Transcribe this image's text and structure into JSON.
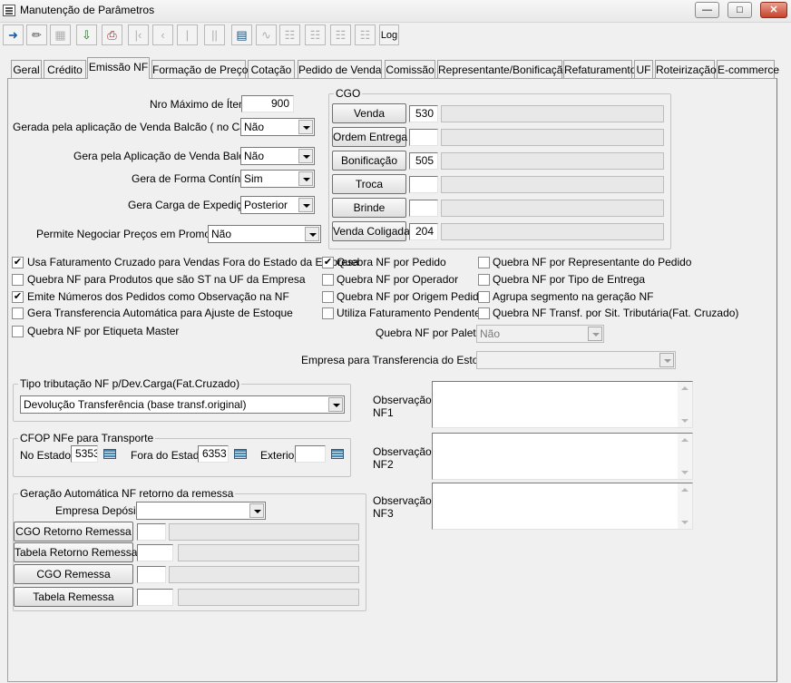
{
  "window": {
    "title": "Manutenção de Parâmetros"
  },
  "toolbar": {
    "log_label": "Log"
  },
  "tabs": [
    {
      "label": "Geral"
    },
    {
      "label": "Crédito"
    },
    {
      "label": "Emissão NF"
    },
    {
      "label": "Formação de Preço"
    },
    {
      "label": "Cotação"
    },
    {
      "label": "Pedido de Venda"
    },
    {
      "label": "Comissão"
    },
    {
      "label": "Representante/Bonificação"
    },
    {
      "label": "Refaturamento"
    },
    {
      "label": "UF"
    },
    {
      "label": "Roteirização"
    },
    {
      "label": "E-commerce"
    }
  ],
  "form": {
    "nro_maximo_itens": {
      "label": "Nro Máximo de Ítens",
      "value": "900"
    },
    "gerada_venda_balcao": {
      "label": "Gerada pela aplicação de Venda Balcão ( no Caixa )",
      "value": "Não"
    },
    "gera_aplicacao_venda_balcao": {
      "label": "Gera pela Aplicação de Venda Balcão",
      "value": "Não"
    },
    "gera_forma_continua": {
      "label": "Gera de Forma Contínua",
      "value": "Sim"
    },
    "gera_carga_expedicao": {
      "label": "Gera Carga de Expedição",
      "value": "Posterior"
    },
    "permite_negociar_precos": {
      "label": "Permite Negociar Preços em Promoção",
      "value": "Não"
    }
  },
  "cgo": {
    "title": "CGO",
    "rows": [
      {
        "label": "Venda",
        "code": "530",
        "desc": ""
      },
      {
        "label": "Ordem Entrega",
        "code": "",
        "desc": ""
      },
      {
        "label": "Bonificação",
        "code": "505",
        "desc": ""
      },
      {
        "label": "Troca",
        "code": "",
        "desc": ""
      },
      {
        "label": "Brinde",
        "code": "",
        "desc": ""
      },
      {
        "label": "Venda Coligada",
        "code": "204",
        "desc": ""
      }
    ]
  },
  "checkboxes": {
    "col1": [
      {
        "label": "Usa Faturamento Cruzado para Vendas Fora do Estado da Empresa",
        "checked": true,
        "mark": "✔"
      },
      {
        "label": "Quebra NF para Produtos que são ST na UF da Empresa",
        "checked": false,
        "mark": ""
      },
      {
        "label": "Emite Números dos Pedidos como Observação na NF",
        "checked": true,
        "mark": "✔"
      },
      {
        "label": "Gera Transferencia Automática para Ajuste de Estoque",
        "checked": false,
        "mark": ""
      },
      {
        "label": "Quebra NF por Etiqueta Master",
        "checked": false,
        "mark": ""
      }
    ],
    "col2": [
      {
        "label": "Quebra NF por Pedido",
        "checked": true,
        "mark": "✔"
      },
      {
        "label": "Quebra NF por Operador",
        "checked": false,
        "mark": ""
      },
      {
        "label": "Quebra NF por Origem Pedido",
        "checked": false,
        "mark": ""
      },
      {
        "label": "Utiliza Faturamento Pendente",
        "checked": false,
        "mark": ""
      }
    ],
    "col3": [
      {
        "label": "Quebra NF por Representante do Pedido",
        "checked": false,
        "mark": ""
      },
      {
        "label": "Quebra NF por Tipo de Entrega",
        "checked": false,
        "mark": ""
      },
      {
        "label": "Agrupa segmento na geração NF",
        "checked": false,
        "mark": ""
      },
      {
        "label": "Quebra NF Transf. por Sit. Tributária(Fat. Cruzado)",
        "checked": false,
        "mark": ""
      }
    ]
  },
  "quebra_palete": {
    "label": "Quebra NF por Palete",
    "value": "Não"
  },
  "empresa_transferencia": {
    "label": "Empresa para Transferencia do Estoque",
    "value": ""
  },
  "tipo_tributacao": {
    "title": "Tipo tributação NF p/Dev.Carga(Fat.Cruzado)",
    "value": "Devolução Transferência (base transf.original)"
  },
  "cfop": {
    "title": "CFOP NFe para Transporte",
    "no_estado": {
      "label": "No Estado",
      "value": "5353"
    },
    "fora_estado": {
      "label": "Fora do Estado",
      "value": "6353"
    },
    "exterior": {
      "label": "Exterior",
      "value": ""
    }
  },
  "geracao": {
    "title": "Geração Automática NF retorno da remessa",
    "empresa_deposito": {
      "label": "Empresa Depósito",
      "value": ""
    },
    "rows": [
      {
        "label": "CGO Retorno Remessa",
        "code": "",
        "desc": ""
      },
      {
        "label": "Tabela Retorno Remessa",
        "code": "",
        "desc": ""
      },
      {
        "label": "CGO Remessa",
        "code": "",
        "desc": ""
      },
      {
        "label": "Tabela Remessa",
        "code": "",
        "desc": ""
      }
    ]
  },
  "observacoes": [
    {
      "label": "Observação NF1",
      "value": ""
    },
    {
      "label": "Observação NF2",
      "value": ""
    },
    {
      "label": "Observação NF3",
      "value": ""
    }
  ]
}
